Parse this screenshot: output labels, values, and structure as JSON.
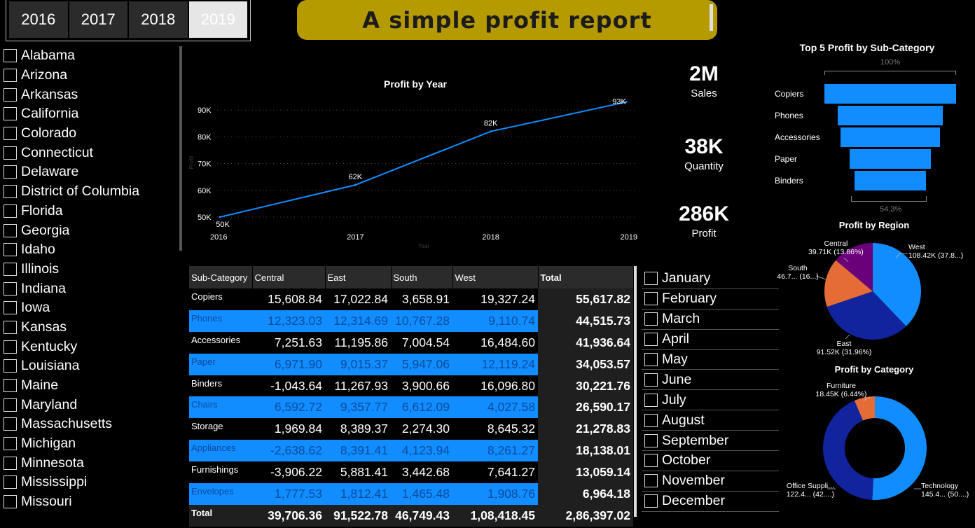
{
  "year_slicer": {
    "years": [
      "2016",
      "2017",
      "2018",
      "2019"
    ],
    "selected": "2019"
  },
  "header": {
    "title": "A simple profit report"
  },
  "states": [
    "Alabama",
    "Arizona",
    "Arkansas",
    "California",
    "Colorado",
    "Connecticut",
    "Delaware",
    "District of Columbia",
    "Florida",
    "Georgia",
    "Idaho",
    "Illinois",
    "Indiana",
    "Iowa",
    "Kansas",
    "Kentucky",
    "Louisiana",
    "Maine",
    "Maryland",
    "Massachusetts",
    "Michigan",
    "Minnesota",
    "Mississippi",
    "Missouri"
  ],
  "months": [
    "January",
    "February",
    "March",
    "April",
    "May",
    "June",
    "July",
    "August",
    "September",
    "October",
    "November",
    "December"
  ],
  "kpis": [
    {
      "value": "2M",
      "label": "Sales"
    },
    {
      "value": "38K",
      "label": "Quantity"
    },
    {
      "value": "286K",
      "label": "Profit"
    }
  ],
  "colors": {
    "accent": "#118dff",
    "dark_blue": "#12239e",
    "orange": "#e66c37",
    "purple": "#6b007b",
    "gold": "#b59a00"
  },
  "chart_data": [
    {
      "type": "line",
      "title": "Profit by Year",
      "xlabel": "Year",
      "ylabel": "Profit",
      "x": [
        "2016",
        "2017",
        "2018",
        "2019"
      ],
      "values": [
        50,
        62,
        82,
        93
      ],
      "data_labels": [
        "50K",
        "62K",
        "82K",
        "93K"
      ],
      "y_ticks": [
        "50K",
        "60K",
        "70K",
        "80K",
        "90K"
      ],
      "ylim": [
        50,
        95
      ],
      "grid": true
    },
    {
      "type": "bar",
      "subtype": "funnel",
      "title": "Top 5 Profit by Sub-Category",
      "categories": [
        "Copiers",
        "Phones",
        "Accessories",
        "Paper",
        "Binders"
      ],
      "values": [
        55617.82,
        44515.73,
        41936.64,
        34053.57,
        30221.76
      ],
      "top_label": "100%",
      "bottom_label": "54.3%"
    },
    {
      "type": "pie",
      "title": "Profit by Region",
      "categories": [
        "West",
        "East",
        "South",
        "Central"
      ],
      "values": [
        108418.45,
        91522.78,
        46749.43,
        39706.36
      ],
      "labels": [
        {
          "name": "West",
          "value": "108.42K (37.8...)"
        },
        {
          "name": "East",
          "value": "91.52K (31.96%)"
        },
        {
          "name": "South",
          "value": "46.7... (16...)"
        },
        {
          "name": "Central",
          "value": "39.71K (13.86%)"
        }
      ]
    },
    {
      "type": "pie",
      "subtype": "donut",
      "title": "Profit by Category",
      "categories": [
        "Technology",
        "Office Supplies",
        "Furniture"
      ],
      "values": [
        145.4,
        122.4,
        18.45
      ],
      "labels": [
        {
          "name": "Technology",
          "value": "145.4... (50....)"
        },
        {
          "name": "Office Suppli...",
          "value": "122.4... (42....)"
        },
        {
          "name": "Furniture",
          "value": "18.45K (6.44%)"
        }
      ]
    }
  ],
  "table": {
    "headers": [
      "Sub-Category",
      "Central",
      "East",
      "South",
      "West",
      "Total"
    ],
    "rows": [
      [
        "Copiers",
        "15,608.84",
        "17,022.84",
        "3,658.91",
        "19,327.24",
        "55,617.82"
      ],
      [
        "Phones",
        "12,323.03",
        "12,314.69",
        "10,767.28",
        "9,110.74",
        "44,515.73"
      ],
      [
        "Accessories",
        "7,251.63",
        "11,195.86",
        "7,004.54",
        "16,484.60",
        "41,936.64"
      ],
      [
        "Paper",
        "6,971.90",
        "9,015.37",
        "5,947.06",
        "12,119.24",
        "34,053.57"
      ],
      [
        "Binders",
        "-1,043.64",
        "11,267.93",
        "3,900.66",
        "16,096.80",
        "30,221.76"
      ],
      [
        "Chairs",
        "6,592.72",
        "9,357.77",
        "6,612.09",
        "4,027.58",
        "26,590.17"
      ],
      [
        "Storage",
        "1,969.84",
        "8,389.37",
        "2,274.30",
        "8,645.32",
        "21,278.83"
      ],
      [
        "Appliances",
        "-2,638.62",
        "8,391.41",
        "4,123.94",
        "8,261.27",
        "18,138.01"
      ],
      [
        "Furnishings",
        "-3,906.22",
        "5,881.41",
        "3,442.68",
        "7,641.27",
        "13,059.14"
      ],
      [
        "Envelopes",
        "1,777.53",
        "1,812.41",
        "1,465.48",
        "1,908.76",
        "6,964.18"
      ]
    ],
    "total_row": [
      "Total",
      "39,706.36",
      "91,522.78",
      "46,749.43",
      "1,08,418.45",
      "2,86,397.02"
    ]
  }
}
